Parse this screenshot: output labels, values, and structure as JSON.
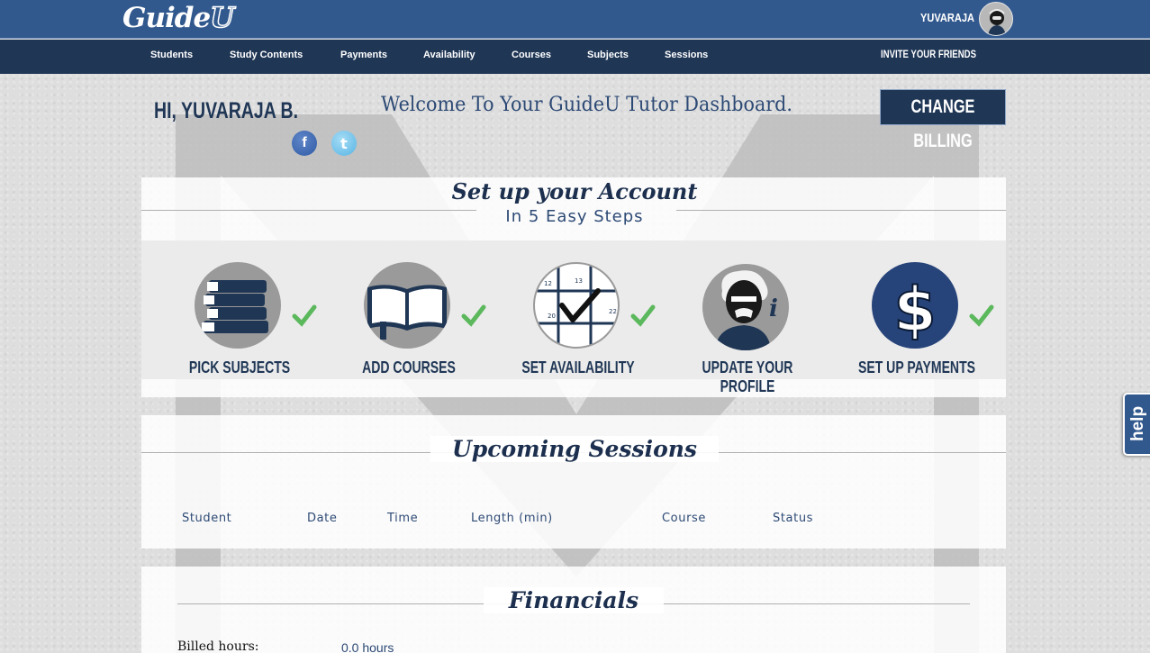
{
  "app": {
    "logo_text": "Guide",
    "logo_u": "U",
    "username": "YUVARAJA"
  },
  "nav": {
    "items": [
      "Students",
      "Study Contents",
      "Payments",
      "Availability",
      "Courses",
      "Subjects",
      "Sessions"
    ],
    "invite": "INVITE YOUR FRIENDS"
  },
  "header": {
    "greeting": "HI, YUVARAJA B.",
    "welcome": "Welcome To Your GuideU Tutor Dashboard.",
    "billing_button": "CHANGE BILLING",
    "social": {
      "facebook": "f",
      "twitter": "t"
    }
  },
  "setup": {
    "title": "Set up your Account",
    "subtitle": "In 5 Easy Steps",
    "steps": [
      {
        "label": "PICK SUBJECTS",
        "completed": true,
        "icon": "books-icon"
      },
      {
        "label": "ADD COURSES",
        "completed": true,
        "icon": "open-book-icon"
      },
      {
        "label": "SET AVAILABILITY",
        "completed": true,
        "icon": "calendar-check-icon"
      },
      {
        "label": "UPDATE YOUR PROFILE",
        "completed": false,
        "icon": "profile-info-icon"
      },
      {
        "label": "SET UP PAYMENTS",
        "completed": true,
        "icon": "dollar-icon"
      }
    ],
    "calendar_numbers": [
      "12",
      "13",
      "20",
      "22"
    ],
    "info_glyph": "i",
    "dollar_glyph": "$"
  },
  "sessions": {
    "title": "Upcoming Sessions",
    "columns": [
      "Student",
      "Date",
      "Time",
      "Length (min)",
      "Course",
      "Status"
    ]
  },
  "financials": {
    "title": "Financials",
    "billed_hours_label": "Billed hours:",
    "billed_hours_value": "0.0 hours"
  },
  "help": {
    "label": "help"
  },
  "colors": {
    "primary": "#32598e",
    "navy": "#1f3655",
    "check_green": "#5cb85c"
  }
}
